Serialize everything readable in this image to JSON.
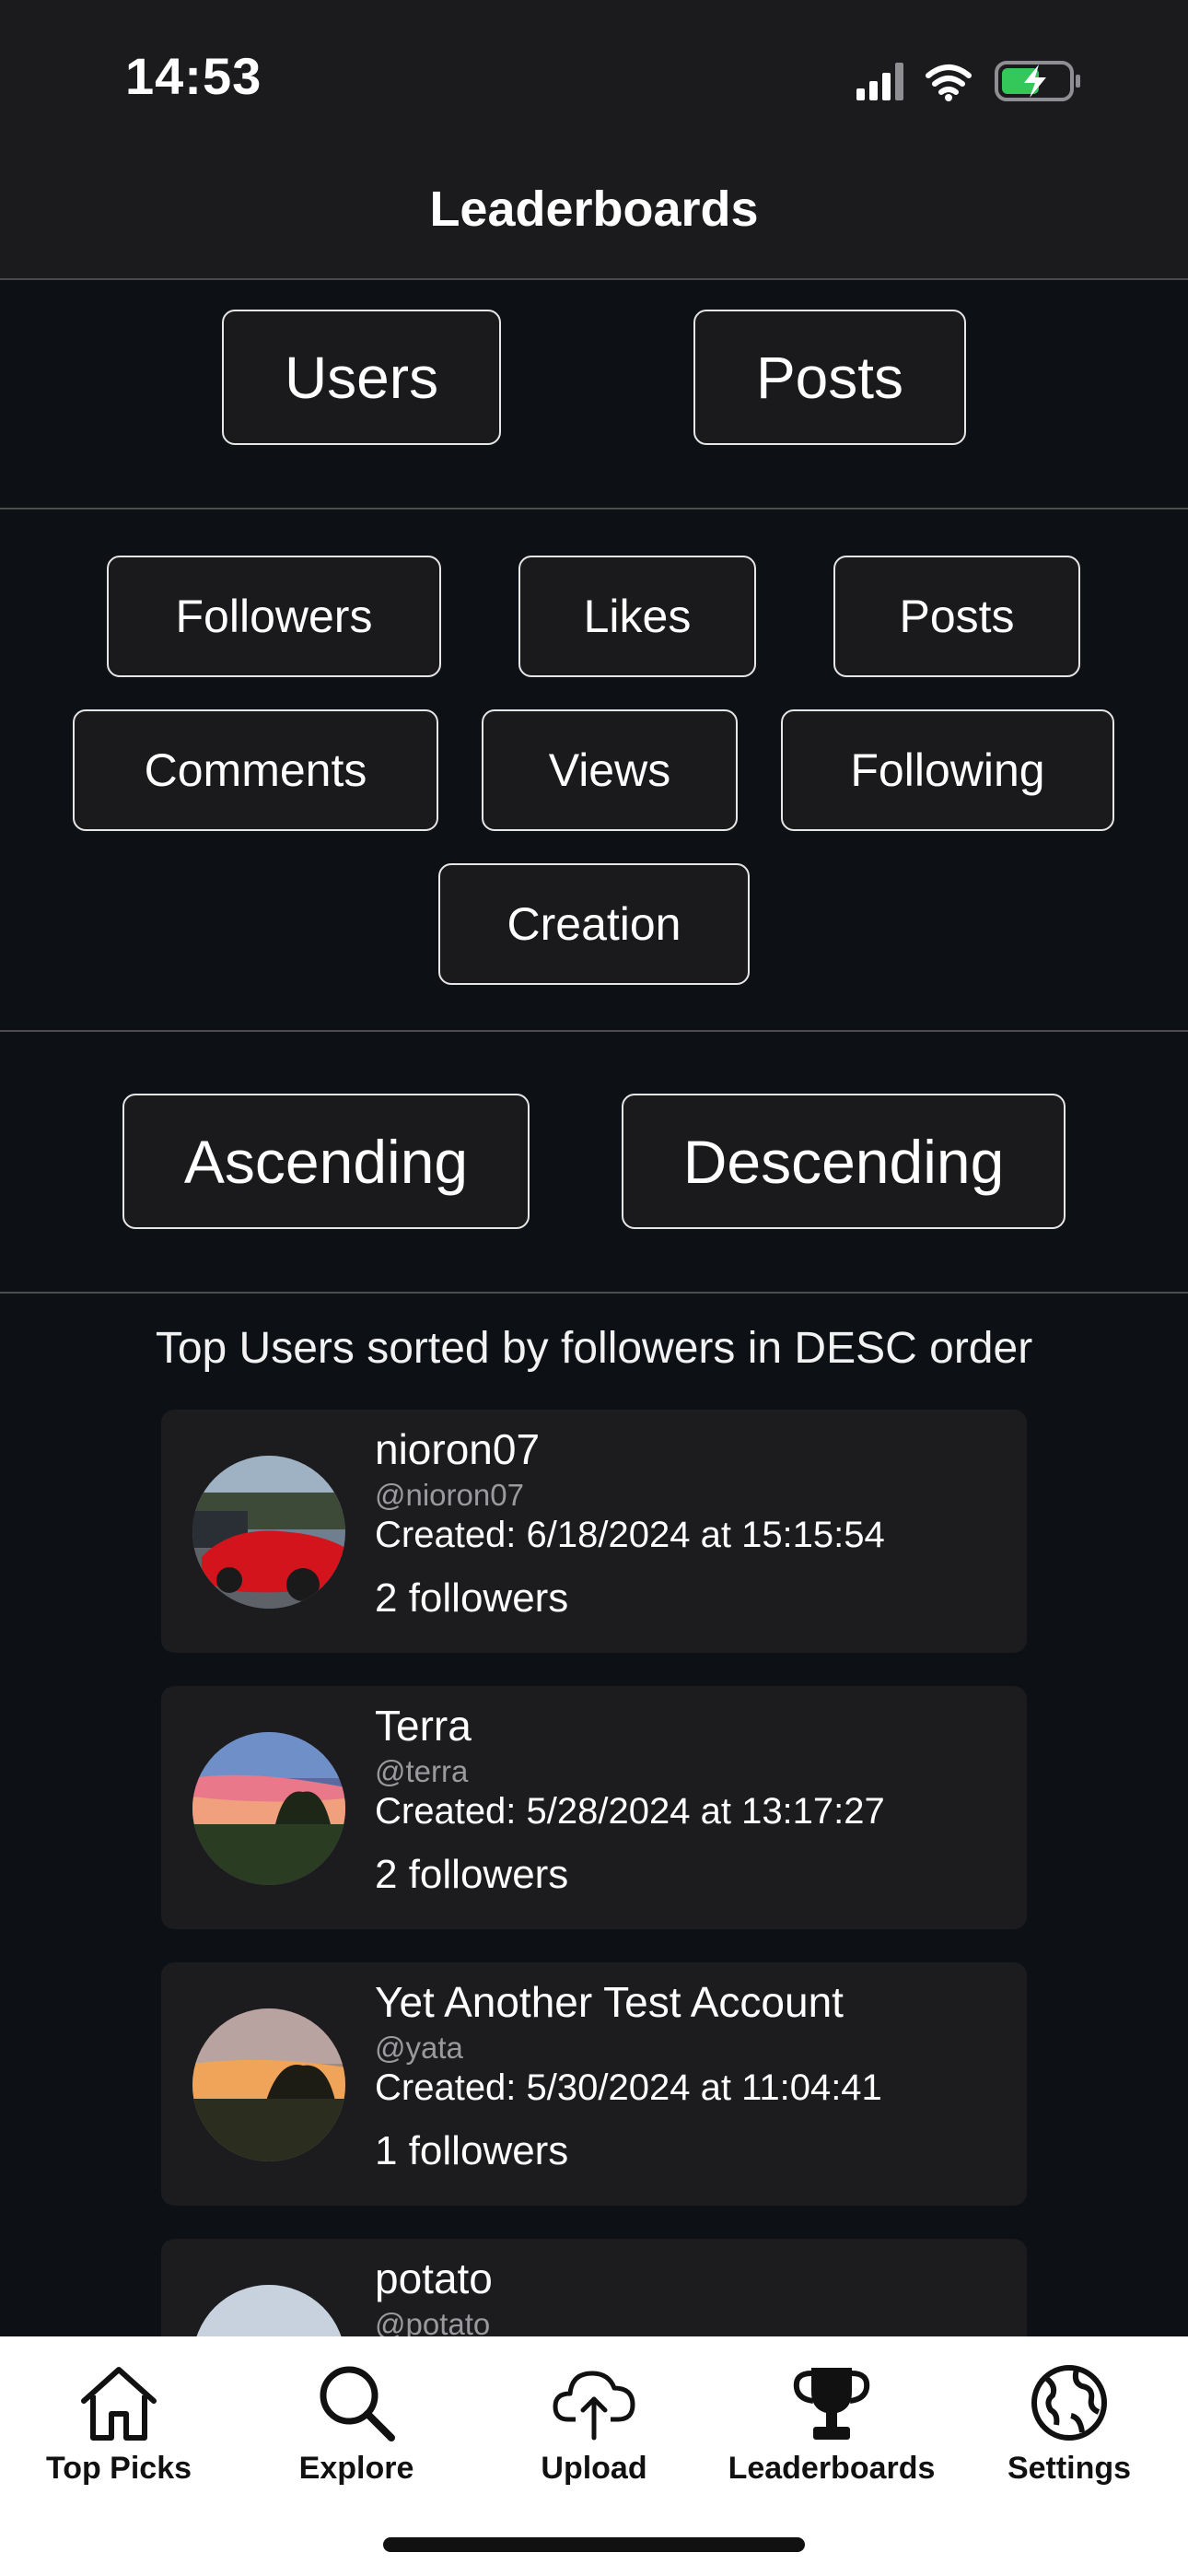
{
  "status": {
    "time": "14:53"
  },
  "header": {
    "title": "Leaderboards"
  },
  "type_tabs": {
    "users": "Users",
    "posts": "Posts"
  },
  "sort_fields": {
    "followers": "Followers",
    "likes": "Likes",
    "posts": "Posts",
    "comments": "Comments",
    "views": "Views",
    "following": "Following",
    "creation": "Creation"
  },
  "order": {
    "ascending": "Ascending",
    "descending": "Descending"
  },
  "caption": "Top Users sorted by followers in DESC order",
  "users": [
    {
      "name": "nioron07",
      "handle": "@nioron07",
      "created": "Created: 6/18/2024 at 15:15:54",
      "followers": "2 followers"
    },
    {
      "name": "Terra",
      "handle": "@terra",
      "created": "Created: 5/28/2024 at 13:17:27",
      "followers": "2 followers"
    },
    {
      "name": "Yet Another Test Account",
      "handle": "@yata",
      "created": "Created: 5/30/2024 at 11:04:41",
      "followers": "1 followers"
    },
    {
      "name": "potato",
      "handle": "@potato"
    }
  ],
  "tabbar": {
    "top_picks": "Top Picks",
    "explore": "Explore",
    "upload": "Upload",
    "leaderboards": "Leaderboards",
    "settings": "Settings"
  },
  "colors": {
    "background": "#0d1014",
    "card": "#1c1c1e",
    "battery": "#34c759"
  }
}
